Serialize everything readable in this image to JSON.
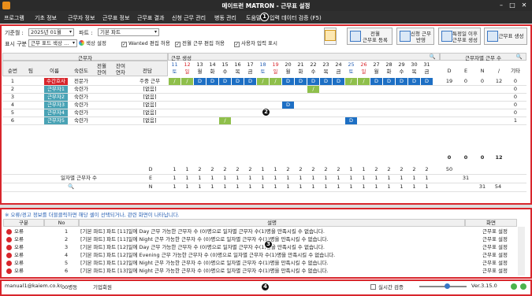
{
  "window": {
    "title": "메이트런 MATRON - 근무표 설정"
  },
  "menu": [
    "프로그램",
    "기초 정보",
    "근무자 정보",
    "근무표 정보",
    "근무표 결과",
    "신청 근무 관리",
    "병동 관리",
    "도움말",
    "입력 데이터 검증 (F5)"
  ],
  "badges": [
    "1",
    "2",
    "3",
    "4"
  ],
  "filters": {
    "period_label": "기준월 :",
    "period_value": "2025년 01월",
    "part_label": "파트 :",
    "part_value": "기본 파트",
    "display_label": "표시 구분 :",
    "display_value": "근무 표드 색상 ...",
    "color_setting": "색상 설정",
    "wanted_edit": "Wanted 편집 허용",
    "all_edit": "전월 근무 편집 허용",
    "show_user": "사용자 입력 표시"
  },
  "buttons": {
    "prev_month": "전월\n근무표 등록",
    "apply_request": "신청 근무\n반영",
    "special": "특정일 이후\n근무표 생성",
    "create": "근무표 생성"
  },
  "grid": {
    "worker_header": "근무자",
    "schedule_header": "근무 생성",
    "count_header": "근무자별 근무 수",
    "col_no": "순번",
    "col_team": "팀",
    "col_name": "이름",
    "col_skill": "숙련도",
    "col_consecutive": "전월\n잔여",
    "col_left": "잔여\n연차",
    "col_duty": "전담",
    "days": [
      {
        "d": "11",
        "w": "토"
      },
      {
        "d": "12",
        "w": "일"
      },
      {
        "d": "13",
        "w": "월"
      },
      {
        "d": "14",
        "w": "화"
      },
      {
        "d": "15",
        "w": "수"
      },
      {
        "d": "16",
        "w": "목"
      },
      {
        "d": "17",
        "w": "금"
      },
      {
        "d": "18",
        "w": "토"
      },
      {
        "d": "19",
        "w": "일"
      },
      {
        "d": "20",
        "w": "월"
      },
      {
        "d": "21",
        "w": "화"
      },
      {
        "d": "22",
        "w": "수"
      },
      {
        "d": "23",
        "w": "목"
      },
      {
        "d": "24",
        "w": "금"
      },
      {
        "d": "25",
        "w": "토"
      },
      {
        "d": "26",
        "w": "일"
      },
      {
        "d": "27",
        "w": "월"
      },
      {
        "d": "28",
        "w": "화"
      },
      {
        "d": "29",
        "w": "수"
      },
      {
        "d": "30",
        "w": "목"
      },
      {
        "d": "31",
        "w": "금"
      }
    ],
    "count_cols": [
      "D",
      "E",
      "N",
      "/",
      "기타"
    ],
    "rows": [
      {
        "no": "1",
        "team": "",
        "name": "수간호사",
        "skill": "전문가",
        "duty": "주중 근무",
        "cells": [
          "/",
          "/",
          "D",
          "D",
          "D",
          "D",
          "D",
          "/",
          "/",
          "D",
          "D",
          "D",
          "D",
          "D",
          "/",
          "/",
          "D",
          "D",
          "D",
          "D",
          "D"
        ],
        "counts": [
          "19",
          "0",
          "0",
          "12",
          "0"
        ]
      },
      {
        "no": "2",
        "team": "",
        "name": "근무자1",
        "skill": "숙련가",
        "duty": "[없음]",
        "cells": [
          "",
          "",
          "",
          "",
          "",
          "",
          "",
          "",
          "",
          "",
          "",
          "/",
          "",
          "",
          "",
          "",
          "",
          "",
          "",
          "",
          ""
        ],
        "counts": [
          "",
          "",
          "",
          "",
          "0"
        ]
      },
      {
        "no": "3",
        "team": "",
        "name": "근무자2",
        "skill": "숙련가",
        "duty": "[없음]",
        "cells": [
          "",
          "",
          "",
          "",
          "",
          "",
          "",
          "",
          "",
          "",
          "",
          "",
          "",
          "",
          "",
          "",
          "",
          "",
          "",
          "",
          ""
        ],
        "counts": [
          "",
          "",
          "",
          "",
          "0"
        ]
      },
      {
        "no": "4",
        "team": "",
        "name": "근무자3",
        "skill": "숙련가",
        "duty": "[없음]",
        "cells": [
          "",
          "",
          "",
          "",
          "",
          "",
          "",
          "",
          "",
          "D",
          "",
          "",
          "",
          "",
          "",
          "",
          "",
          "",
          "",
          "",
          ""
        ],
        "counts": [
          "",
          "",
          "",
          "",
          "0"
        ]
      },
      {
        "no": "5",
        "team": "",
        "name": "근무자4",
        "skill": "숙련가",
        "duty": "[없음]",
        "cells": [
          "",
          "",
          "",
          "",
          "",
          "",
          "",
          "",
          "",
          "",
          "",
          "",
          "",
          "",
          "",
          "",
          "",
          "",
          "",
          "",
          ""
        ],
        "counts": [
          "",
          "",
          "",
          "",
          "0"
        ]
      },
      {
        "no": "6",
        "team": "",
        "name": "근무자5",
        "skill": "숙련가",
        "duty": "[없음]",
        "cells": [
          "",
          "",
          "",
          "",
          "/",
          "",
          "",
          "",
          "",
          "",
          "",
          "",
          "",
          "",
          "D",
          "",
          "",
          "",
          "",
          "",
          ""
        ],
        "counts": [
          "",
          "",
          "",
          "",
          "1"
        ]
      }
    ],
    "totals_label": "0",
    "totals": [
      "0",
      "0",
      "0",
      "12"
    ],
    "daily_label": "일자별 근무자 수",
    "daily": [
      {
        "k": "D",
        "v": [
          "1",
          "1",
          "2",
          "2",
          "2",
          "2",
          "2",
          "1",
          "1",
          "2",
          "2",
          "2",
          "2",
          "2",
          "1",
          "1",
          "2",
          "2",
          "2",
          "2",
          "2"
        ],
        "sum": "50"
      },
      {
        "k": "E",
        "v": [
          "1",
          "1",
          "1",
          "1",
          "1",
          "1",
          "1",
          "1",
          "1",
          "1",
          "1",
          "1",
          "1",
          "1",
          "1",
          "1",
          "1",
          "1",
          "1",
          "1",
          "1"
        ],
        "sum": "31"
      },
      {
        "k": "N",
        "v": [
          "1",
          "1",
          "1",
          "1",
          "1",
          "1",
          "1",
          "1",
          "1",
          "1",
          "1",
          "1",
          "1",
          "1",
          "1",
          "1",
          "1",
          "1",
          "1",
          "1",
          "1"
        ],
        "sum": "31",
        "extra": "54"
      }
    ]
  },
  "messages": {
    "info": "※ 오류/경고 정보를 더블클릭하면 해당 셀이 선택되거나, 관련 화면이 나타납니다.",
    "col_type": "구분",
    "col_no": "No",
    "col_desc": "설명",
    "col_screen": "화면",
    "rows": [
      {
        "type": "오류",
        "no": "1",
        "desc": "[기본 파트] 파트 [11]일에 Day 근무 가능한 근무자 수 (0)명으로 일자별 근무자 수(1)명을 만족시킬 수 없습니다.",
        "screen": "근무표 설정"
      },
      {
        "type": "오류",
        "no": "2",
        "desc": "[기본 파트] 파트 [11]일에 Night 근무 가능한 근무자 수 (0)명으로 일자별 근무자 수(1)명을 만족시킬 수 없습니다.",
        "screen": "근무표 설정"
      },
      {
        "type": "오류",
        "no": "3",
        "desc": "[기본 파트] 파트 [12]일에 Day 근무 가능한 근무자 수 (0)명으로 일자별 근무자 수(1)명을 만족시킬 수 없습니다.",
        "screen": "근무표 설정"
      },
      {
        "type": "오류",
        "no": "4",
        "desc": "[기본 파트] 파트 [12]일에 Evening 근무 가능한 근무자 수 (0)명으로 일자별 근무자 수(1)명을 만족시킬 수 없습니다.",
        "screen": "근무표 설정"
      },
      {
        "type": "오류",
        "no": "5",
        "desc": "[기본 파트] 파트 [12]일에 Night 근무 가능한 근무자 수 (0)명으로 일자별 근무자 수(1)명을 만족시킬 수 없습니다.",
        "screen": "근무표 설정"
      },
      {
        "type": "오류",
        "no": "6",
        "desc": "[기본 파트] 파트 [13]일에 Night 근무 가능한 근무자 수 (0)명으로 일자별 근무자 수(1)명을 만족시킬 수 없습니다.",
        "screen": "근무표 설정"
      }
    ]
  },
  "status": {
    "email": "manual1@kaiem.co.kr",
    "ward": "00병동",
    "plan": "기업회원",
    "realtime": "실시간 검증",
    "version": "Ver.3.15.0"
  },
  "colors": {
    "accent": "#d8262c",
    "dark": "#2b2b2b",
    "teal": "#4aa3b5",
    "blue": "#1d6fc4",
    "green": "#8fbf4b"
  }
}
